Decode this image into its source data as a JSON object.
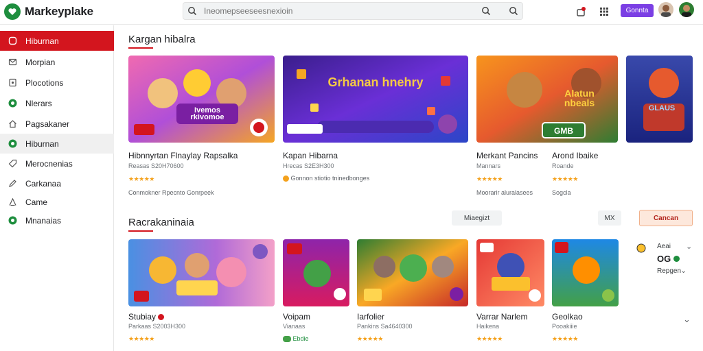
{
  "brand": {
    "name": "Markeyplake"
  },
  "search": {
    "placeholder": "Ineomepseeseesnexioin"
  },
  "header": {
    "button_label": "Gonnta"
  },
  "colors": {
    "accent": "#d3151e",
    "brand": "#1e8e3e",
    "purple": "#7b3fe4",
    "star": "#f4a11c"
  },
  "sidebar": {
    "items": [
      {
        "label": "Hiburnan",
        "icon": "home-icon"
      },
      {
        "label": "Morpian",
        "icon": "mail-icon"
      },
      {
        "label": "Plocotions",
        "icon": "document-icon"
      },
      {
        "label": "Nlerars",
        "icon": "green-badge-icon"
      },
      {
        "label": "Pagsakaner",
        "icon": "house-icon"
      },
      {
        "label": "Hiburnan",
        "icon": "green-badge-icon"
      },
      {
        "label": "Merocnenias",
        "icon": "tag-icon"
      },
      {
        "label": "Carkanaa",
        "icon": "pencil-icon"
      },
      {
        "label": "Came",
        "icon": "person-icon"
      },
      {
        "label": "Mnanaias",
        "icon": "green-badge-icon"
      }
    ]
  },
  "section1": {
    "title": "Kargan hibalra",
    "cards": [
      {
        "title": "Hibnnyrtan  Flnaylay Rapsalka",
        "sub": "Reasas  S20H70600",
        "stars": "★★★★★",
        "note": "Conmokner Rpecnto Gonrpeek",
        "badge": "Ivemos rkivomoe"
      },
      {
        "title": "Kapan Hibarna",
        "sub": "Hrecas  S2E3H300",
        "note": "Gonnon  stiotio tninedbonges",
        "badge": "Grhanan  hnehry"
      },
      {
        "title": "Merkant Pancins",
        "sub": "Mannars",
        "stars": "★★★★★",
        "note": "Moorarir  aluralasees",
        "badge": "Alatun  nbeals"
      },
      {
        "title": "Arond Ibaike",
        "sub": "Roande",
        "stars": "★★★★★",
        "note": "Sogcla"
      }
    ]
  },
  "section2": {
    "title": "Racrakaninaia",
    "pills": {
      "filter": "Miaegizt",
      "close": "MX",
      "action": "Cancan"
    },
    "cards": [
      {
        "title": "Stubiay",
        "sub": "Parkaas  S2003H300",
        "stars": "★★★★★"
      },
      {
        "title": "Voipam",
        "sub": "Vianaas",
        "badge": "Ebdie"
      },
      {
        "title": "Iarfolier",
        "sub": "Pankins  Sa4640300",
        "stars": "★★★★★"
      },
      {
        "title": "Varrar Narlem",
        "sub": "Haikena",
        "stars": "★★★★★"
      },
      {
        "title": "Geolkao",
        "sub": "Pooakiiie",
        "stars": "★★★★★"
      }
    ]
  },
  "right_panel": {
    "label": "Aeai",
    "value": "OG",
    "link": "Repgen"
  }
}
